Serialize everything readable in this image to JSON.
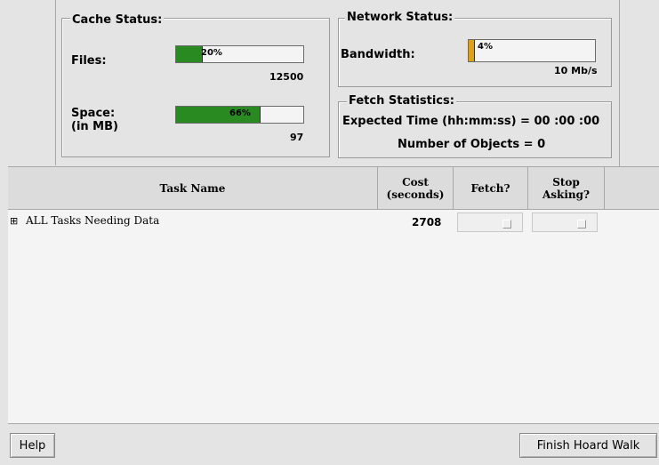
{
  "cache": {
    "legend": "Cache Status:",
    "files_label": "Files:",
    "files_pct": "20%",
    "files_fraction": 0.2,
    "files_total": "12500",
    "space_label": "Space:",
    "space_unit": "(in MB)",
    "space_pct": "66%",
    "space_fraction": 0.66,
    "space_total": "97"
  },
  "network": {
    "legend": "Network Status:",
    "bandwidth_label": "Bandwidth:",
    "bandwidth_pct": "4%",
    "bandwidth_fraction": 0.04,
    "bandwidth_rate": "10 Mb/s"
  },
  "fetch": {
    "legend": "Fetch Statistics:",
    "expected_time": "Expected Time (hh:mm:ss) = 00 :00 :00",
    "num_objects": "Number of Objects = 0"
  },
  "table": {
    "columns": {
      "task_name": "Task Name",
      "cost_line1": "Cost",
      "cost_line2": "(seconds)",
      "fetch": "Fetch?",
      "stop_line1": "Stop",
      "stop_line2": "Asking?"
    },
    "rows": [
      {
        "expander": "⊞",
        "name": "ALL Tasks Needing Data",
        "cost": "2708",
        "fetch": false,
        "stop": false
      }
    ]
  },
  "buttons": {
    "help": "Help",
    "finish": "Finish Hoard Walk"
  },
  "colors": {
    "progress_green": "#2a8a22",
    "progress_orange": "#e0a010"
  }
}
